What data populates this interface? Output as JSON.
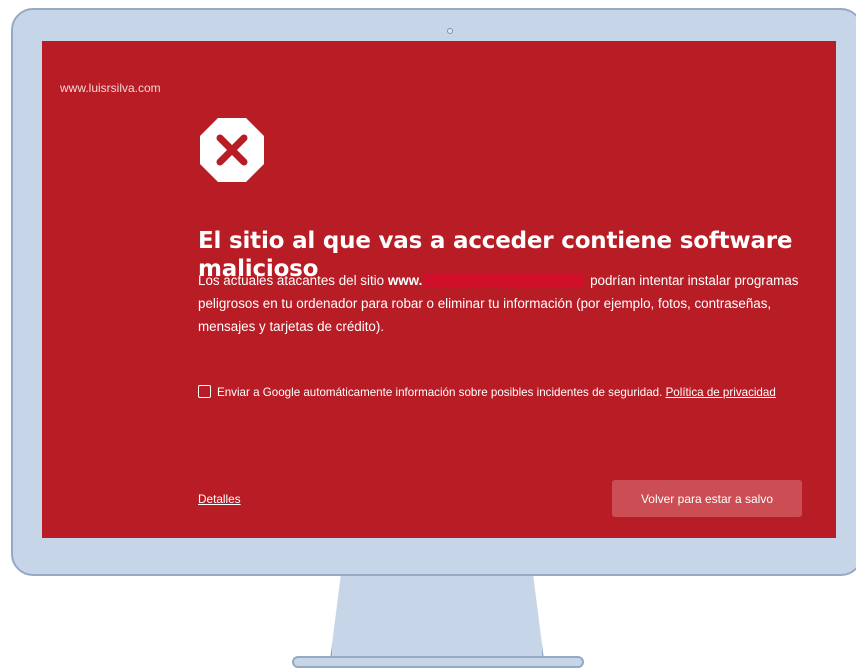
{
  "watermark": "www.luisrsilva.com",
  "warning": {
    "icon": "danger-icon",
    "title": "El sitio al que vas a acceder contiene software malicioso",
    "description_prefix": "Los actuales atacantes del sitio",
    "site_visible": "www.",
    "description_suffix": "podrían intentar instalar programas peligrosos en tu ordenador para robar o eliminar tu información (por ejemplo, fotos, contraseñas, mensajes y tarjetas de crédito)."
  },
  "consent": {
    "checked": false,
    "label": "Enviar a Google automáticamente información sobre posibles incidentes de seguridad.",
    "privacy_link": "Política de privacidad"
  },
  "actions": {
    "details_label": "Detalles",
    "back_to_safety_label": "Volver para estar a salvo"
  },
  "colors": {
    "page_background": "#b81c25",
    "button_background": "#cc4e54",
    "icon_x": "#b81c25"
  }
}
